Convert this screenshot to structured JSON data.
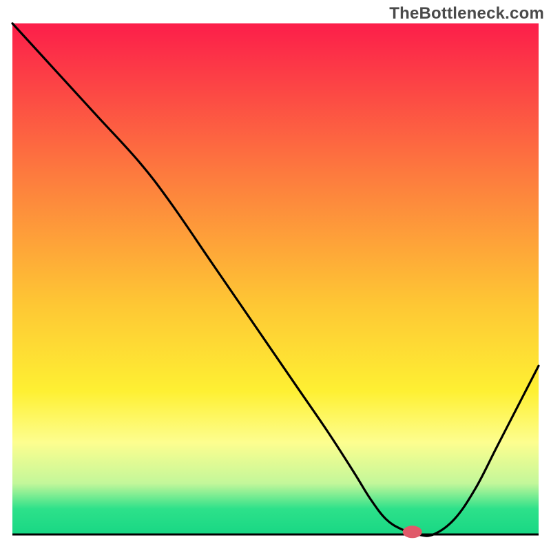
{
  "watermark": {
    "text": "TheBottleneck.com"
  },
  "chart_data": {
    "type": "line",
    "title": "",
    "xlabel": "",
    "ylabel": "",
    "xlim": [
      0,
      100
    ],
    "ylim": [
      0,
      100
    ],
    "background_gradient": {
      "stops": [
        {
          "offset": 0,
          "color": "#fc1e4a"
        },
        {
          "offset": 30,
          "color": "#fd7c3e"
        },
        {
          "offset": 55,
          "color": "#fec734"
        },
        {
          "offset": 72,
          "color": "#fef033"
        },
        {
          "offset": 82,
          "color": "#fdfe8f"
        },
        {
          "offset": 90,
          "color": "#c3f79a"
        },
        {
          "offset": 95,
          "color": "#2de18a"
        },
        {
          "offset": 100,
          "color": "#18d784"
        }
      ]
    },
    "series": [
      {
        "name": "bottleneck-curve",
        "x": [
          0,
          8,
          16,
          24,
          30,
          38,
          46,
          54,
          60,
          65,
          68,
          71,
          74,
          77,
          80,
          84,
          88,
          92,
          96,
          100
        ],
        "y": [
          100,
          91,
          82,
          73,
          65,
          53,
          41,
          29,
          20,
          12,
          7,
          3,
          1,
          0,
          0,
          3,
          9,
          17,
          25,
          33
        ]
      }
    ],
    "marker": {
      "x": 76,
      "y": 0.5,
      "color": "#e05a6a",
      "rx": 14,
      "ry": 9
    },
    "baseline": {
      "y": 0,
      "color": "#000000",
      "width": 3
    }
  }
}
